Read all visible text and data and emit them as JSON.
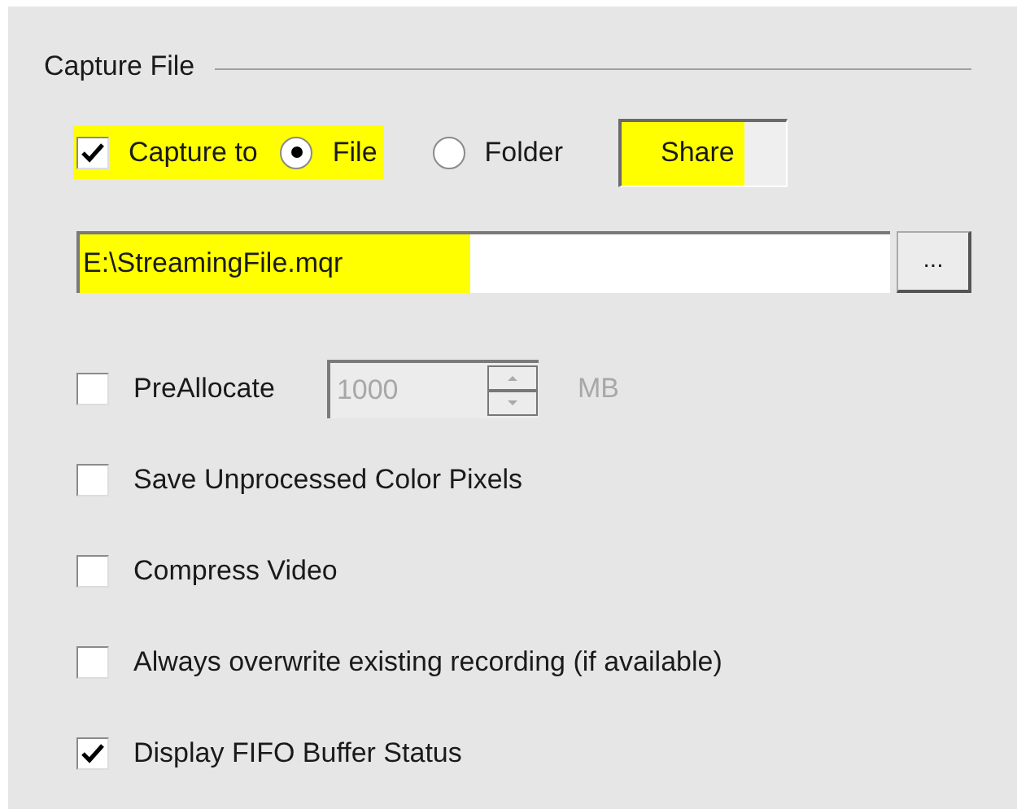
{
  "group": {
    "title": "Capture File"
  },
  "capture": {
    "label": "Capture to",
    "checked": true,
    "highlighted": true
  },
  "destinations": [
    {
      "label": "File",
      "selected": true,
      "highlighted": true
    },
    {
      "label": "Folder",
      "selected": false,
      "highlighted": false
    }
  ],
  "share_button": {
    "label": "Share",
    "highlighted": true
  },
  "path_field": {
    "value": "E:\\StreamingFile.mqr",
    "highlighted": true
  },
  "browse_button": {
    "label": "..."
  },
  "preallocate": {
    "label": "PreAllocate",
    "checked": false,
    "value": "1000",
    "unit": "MB",
    "disabled": true
  },
  "options": [
    {
      "label": "Save Unprocessed Color Pixels",
      "checked": false
    },
    {
      "label": "Compress Video",
      "checked": false
    },
    {
      "label": "Always overwrite existing recording (if available)",
      "checked": false
    },
    {
      "label": "Display FIFO Buffer Status",
      "checked": true
    }
  ]
}
